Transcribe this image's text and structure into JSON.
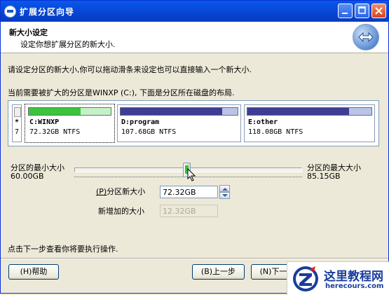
{
  "window": {
    "title": "扩展分区向导"
  },
  "header": {
    "title": "新大小设定",
    "subtitle": "设定你想扩展分区的新大小."
  },
  "instructions": {
    "line1": "请设定分区的新大小,你可以拖动滑条来设定也可以直接输入一个新大小.",
    "line2": "当前需要被扩大的分区是WINXP (C:), 下面是分区所在磁盘的布局."
  },
  "disk": {
    "unallocated": {
      "star": "*",
      "num": "7"
    },
    "partitions": [
      {
        "name": "C:WINXP",
        "size": "72.32GB NTFS",
        "used_fraction": 0.63,
        "color": "#3cc43c"
      },
      {
        "name": "D:program",
        "size": "107.68GB NTFS",
        "used_fraction": 0.87,
        "color": "#3d3d94"
      },
      {
        "name": "E:other",
        "size": "118.08GB NTFS",
        "used_fraction": 0.82,
        "color": "#3d3d94"
      }
    ]
  },
  "slider": {
    "min_label": "分区的最小大小",
    "min_value": "60.00GB",
    "max_label": "分区的最大大小",
    "max_value": "85.15GB",
    "position_fraction": 0.5
  },
  "fields": {
    "new_size_prefix": "(P)",
    "new_size_label": "分区新大小",
    "new_size_value": "72.32GB",
    "added_label": "新增加的大小",
    "added_value": "12.32GB"
  },
  "footer": {
    "hint": "点击下一步查看你将要执行操作."
  },
  "buttons": {
    "help": "(H)帮助",
    "back": "(B)上一步",
    "next": "(N)下一步"
  },
  "watermark": {
    "text": "这里教程网",
    "url": "herecours.com"
  }
}
